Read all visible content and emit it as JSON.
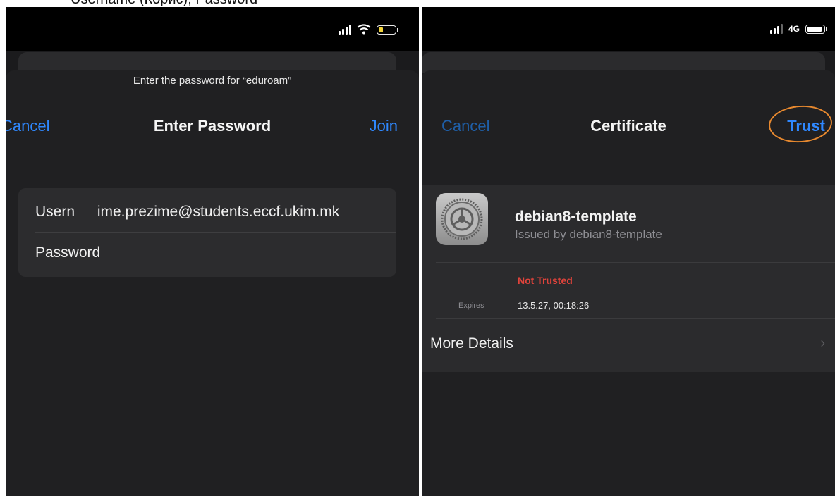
{
  "caption": "Username (Корис), Password",
  "left": {
    "status": {
      "battery_color": "#f2d43a"
    },
    "prompt": "Enter the password for “eduroam”",
    "nav": {
      "cancel": "Cancel",
      "title": "Enter Password",
      "join": "Join"
    },
    "form": {
      "username_label": "Usern",
      "username_value": "ime.prezime@students.eccf.ukim.mk",
      "password_label": "Password",
      "password_value": ""
    }
  },
  "right": {
    "status": {
      "network": "4G",
      "battery_color": "#ffffff"
    },
    "nav": {
      "cancel": "Cancel",
      "title": "Certificate",
      "trust": "Trust"
    },
    "certificate": {
      "name": "debian8-template",
      "issued_by": "Issued by debian8-template",
      "status": "Not Trusted",
      "expires_label": "Expires",
      "expires_value": "13.5.27, 00:18:26"
    },
    "more_details": "More Details",
    "colors": {
      "accent": "#2f88ff",
      "warning": "#e0433b",
      "highlight_ring": "#e8892f"
    }
  }
}
